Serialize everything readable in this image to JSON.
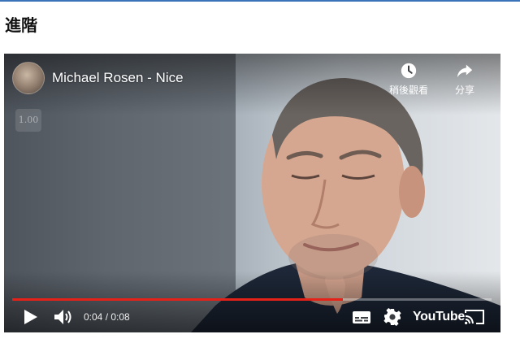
{
  "page": {
    "heading": "進階"
  },
  "player": {
    "title": "Michael Rosen - Nice",
    "speed_badge": "1.00",
    "watch_later_label": "稍後觀看",
    "share_label": "分享",
    "current_time": "0:04",
    "duration": "0:08",
    "time_text": "0:04 / 0:08",
    "progress": 0.69,
    "logo_text": "YouTube",
    "accent_color": "#e62117"
  },
  "icons": {
    "play": "play-icon",
    "volume": "volume-icon",
    "captions": "captions-icon",
    "settings": "gear-icon",
    "cast": "cast-icon",
    "watch_later": "clock-icon",
    "share": "share-arrow-icon"
  }
}
